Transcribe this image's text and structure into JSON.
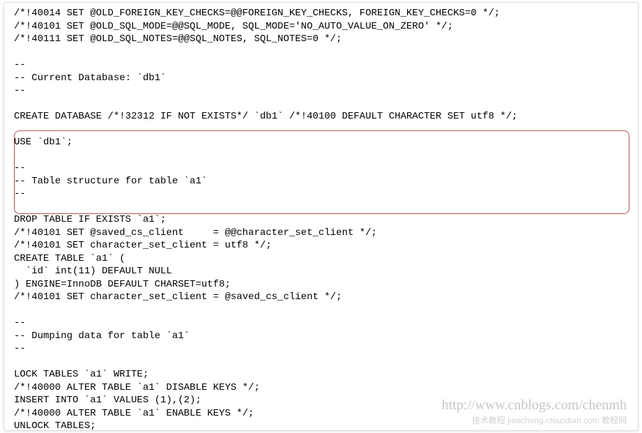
{
  "sql_lines": [
    "/*!40014 SET @OLD_FOREIGN_KEY_CHECKS=@@FOREIGN_KEY_CHECKS, FOREIGN_KEY_CHECKS=0 */;",
    "/*!40101 SET @OLD_SQL_MODE=@@SQL_MODE, SQL_MODE='NO_AUTO_VALUE_ON_ZERO' */;",
    "/*!40111 SET @OLD_SQL_NOTES=@@SQL_NOTES, SQL_NOTES=0 */;",
    "",
    "--",
    "-- Current Database: `db1`",
    "--",
    "",
    "CREATE DATABASE /*!32312 IF NOT EXISTS*/ `db1` /*!40100 DEFAULT CHARACTER SET utf8 */;",
    "",
    "USE `db1`;",
    "",
    "--",
    "-- Table structure for table `a1`",
    "--",
    "",
    "DROP TABLE IF EXISTS `a1`;",
    "/*!40101 SET @saved_cs_client     = @@character_set_client */;",
    "/*!40101 SET character_set_client = utf8 */;",
    "CREATE TABLE `a1` (",
    "  `id` int(11) DEFAULT NULL",
    ") ENGINE=InnoDB DEFAULT CHARSET=utf8;",
    "/*!40101 SET character_set_client = @saved_cs_client */;",
    "",
    "--",
    "-- Dumping data for table `a1`",
    "--",
    "",
    "LOCK TABLES `a1` WRITE;",
    "/*!40000 ALTER TABLE `a1` DISABLE KEYS */;",
    "INSERT INTO `a1` VALUES (1),(2);",
    "/*!40000 ALTER TABLE `a1` ENABLE KEYS */;",
    "UNLOCK TABLES;"
  ],
  "watermark_url": "http://www.cnblogs.com/chenmh",
  "watermark_source": "技术教程 jiaocheng.chazidian.com 教程网"
}
